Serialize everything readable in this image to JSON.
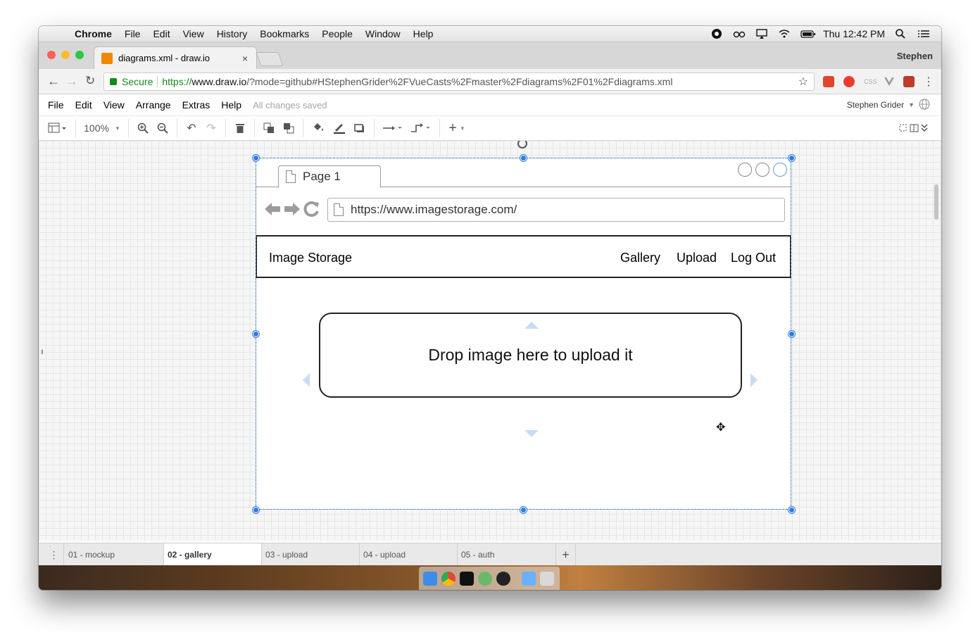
{
  "mac_menubar": {
    "app": "Chrome",
    "items": [
      "File",
      "Edit",
      "View",
      "History",
      "Bookmarks",
      "People",
      "Window",
      "Help"
    ],
    "clock": "Thu 12:42 PM"
  },
  "browser": {
    "tab_title": "diagrams.xml - draw.io",
    "tab_close": "×",
    "profile": "Stephen",
    "secure_label": "Secure",
    "url_proto": "https://",
    "url_host": "www.draw.io",
    "url_rest": "/?mode=github#HStephenGrider%2FVueCasts%2Fmaster%2Fdiagrams%2F01%2Fdiagrams.xml"
  },
  "drawio": {
    "menu": [
      "File",
      "Edit",
      "View",
      "Arrange",
      "Extras",
      "Help"
    ],
    "save_status": "All changes saved",
    "user": "Stephen Grider",
    "zoom": "100%"
  },
  "mockup": {
    "tab_label": "Page 1",
    "url": "https://www.imagestorage.com/",
    "brand": "Image Storage",
    "nav_links": [
      "Gallery",
      "Upload",
      "Log Out"
    ],
    "dropzone_text": "Drop image here to upload it"
  },
  "pages": {
    "tabs": [
      "01 - mockup",
      "02 - gallery",
      "03 - upload",
      "04 - upload",
      "05 - auth"
    ],
    "active_index": 1,
    "add_label": "+"
  },
  "colors": {
    "selection": "#2f7de1",
    "secure_green": "#168a1c",
    "drawio_orange": "#f08705"
  }
}
